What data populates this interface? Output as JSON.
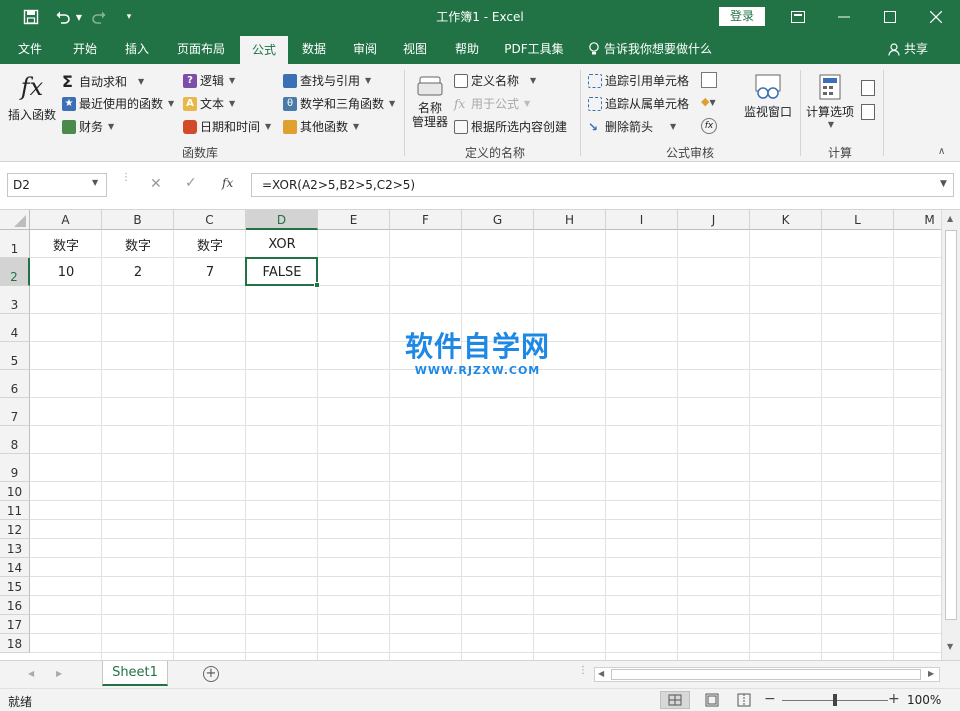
{
  "window": {
    "title": "工作簿1  -  Excel",
    "login_label": "登录"
  },
  "menu": {
    "tabs": [
      "文件",
      "开始",
      "插入",
      "页面布局",
      "公式",
      "数据",
      "审阅",
      "视图",
      "帮助",
      "PDF工具集"
    ],
    "active_tab": "公式",
    "tell_me": "告诉我你想要做什么",
    "share": "共享"
  },
  "ribbon": {
    "function_library": {
      "group_label": "函数库",
      "insert_function": "插入函数",
      "autosum": "自动求和",
      "recently_used": "最近使用的函数",
      "financial": "财务",
      "logical": "逻辑",
      "text": "文本",
      "date_time": "日期和时间",
      "lookup_reference": "查找与引用",
      "math_trig": "数学和三角函数",
      "more_functions": "其他函数"
    },
    "defined_names": {
      "group_label": "定义的名称",
      "name_manager_line1": "名称",
      "name_manager_line2": "管理器",
      "define_name": "定义名称",
      "use_in_formula": "用于公式",
      "create_from_selection": "根据所选内容创建"
    },
    "formula_auditing": {
      "group_label": "公式审核",
      "trace_precedents": "追踪引用单元格",
      "trace_dependents": "追踪从属单元格",
      "remove_arrows": "删除箭头",
      "watch_window": "监视窗口"
    },
    "calculation": {
      "group_label": "计算",
      "calc_options": "计算选项"
    }
  },
  "formula_bar": {
    "name_box": "D2",
    "formula": "=XOR(A2>5,B2>5,C2>5)",
    "fx": "fx"
  },
  "sheet": {
    "columns": [
      "A",
      "B",
      "C",
      "D",
      "E",
      "F",
      "G",
      "H",
      "I",
      "J",
      "K",
      "L",
      "M"
    ],
    "rows": [
      "1",
      "2",
      "3",
      "4",
      "5",
      "6",
      "7",
      "8",
      "9",
      "10",
      "11",
      "12",
      "13",
      "14",
      "15",
      "16",
      "17",
      "18"
    ],
    "cells": {
      "A1": "数字",
      "B1": "数字",
      "C1": "数字",
      "D1": "XOR",
      "A2": "10",
      "B2": "2",
      "C2": "7",
      "D2": "FALSE"
    },
    "active_cell": "D2"
  },
  "sheet_tabs": [
    "Sheet1"
  ],
  "status": {
    "ready": "就绪",
    "zoom": "100%"
  },
  "watermark": {
    "text": "软件自学网",
    "url": "WWW.RJZXW.COM"
  },
  "colors": {
    "brand": "#217346",
    "watermark": "#1e88e5"
  }
}
